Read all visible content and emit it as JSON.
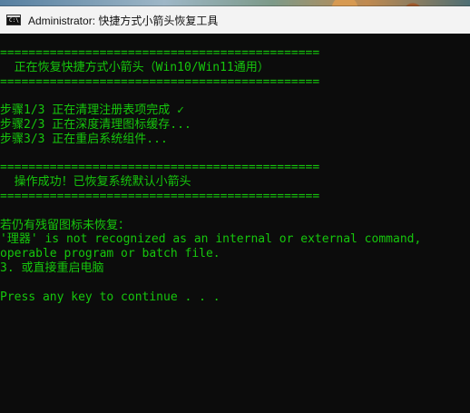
{
  "window": {
    "title": "Administrator:  快捷方式小箭头恢复工具",
    "icon_name": "cmd-icon"
  },
  "console": {
    "separator_1": "=============================================",
    "header": "  正在恢复快捷方式小箭头（Win10/Win11通用）",
    "separator_2": "=============================================",
    "step_1": "步骤1/3 正在清理注册表项完成 ✓",
    "step_2": "步骤2/3 正在深度清理图标缓存...",
    "step_3": "步骤3/3 正在重启系统组件...",
    "separator_3": "=============================================",
    "success": "  操作成功！已恢复系统默认小箭头",
    "separator_4": "=============================================",
    "note_intro": "若仍有残留图标未恢复：",
    "error_line_1": "'理器' is not recognized as an internal or external command,",
    "error_line_2": "operable program or batch file.",
    "note_option_3": "3. 或直接重启电脑",
    "prompt": "Press any key to continue . . ."
  },
  "colors": {
    "console_background": "#0c0c0c",
    "console_text": "#16c60c",
    "title_bar": "#f3f3f3"
  }
}
